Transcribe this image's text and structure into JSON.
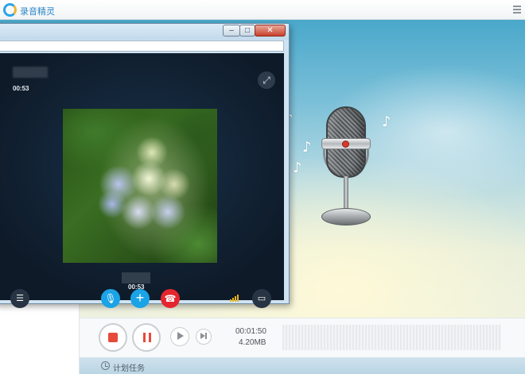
{
  "app": {
    "title": "录音精灵"
  },
  "call_window": {
    "timer_top": "00:53",
    "timer_bottom": "00:53",
    "window_buttons": {
      "minimize": "–",
      "maximize": "□",
      "close": "✕"
    }
  },
  "recorder": {
    "elapsed": "00:01:50",
    "file_size": "4.20MB",
    "scheduled_task_label": "计划任务"
  },
  "icons": {
    "notes": [
      "♪",
      "♪",
      "♪",
      "♪"
    ],
    "expand": "⤢",
    "list": "☰",
    "mic": "🎙",
    "add": "+",
    "hangup": "☎",
    "chat": "▭"
  },
  "colors": {
    "accent_blue": "#1aa3e6",
    "hangup_red": "#e5262f",
    "record_red": "#e64a3b",
    "signal_yellow": "#e9b516"
  }
}
